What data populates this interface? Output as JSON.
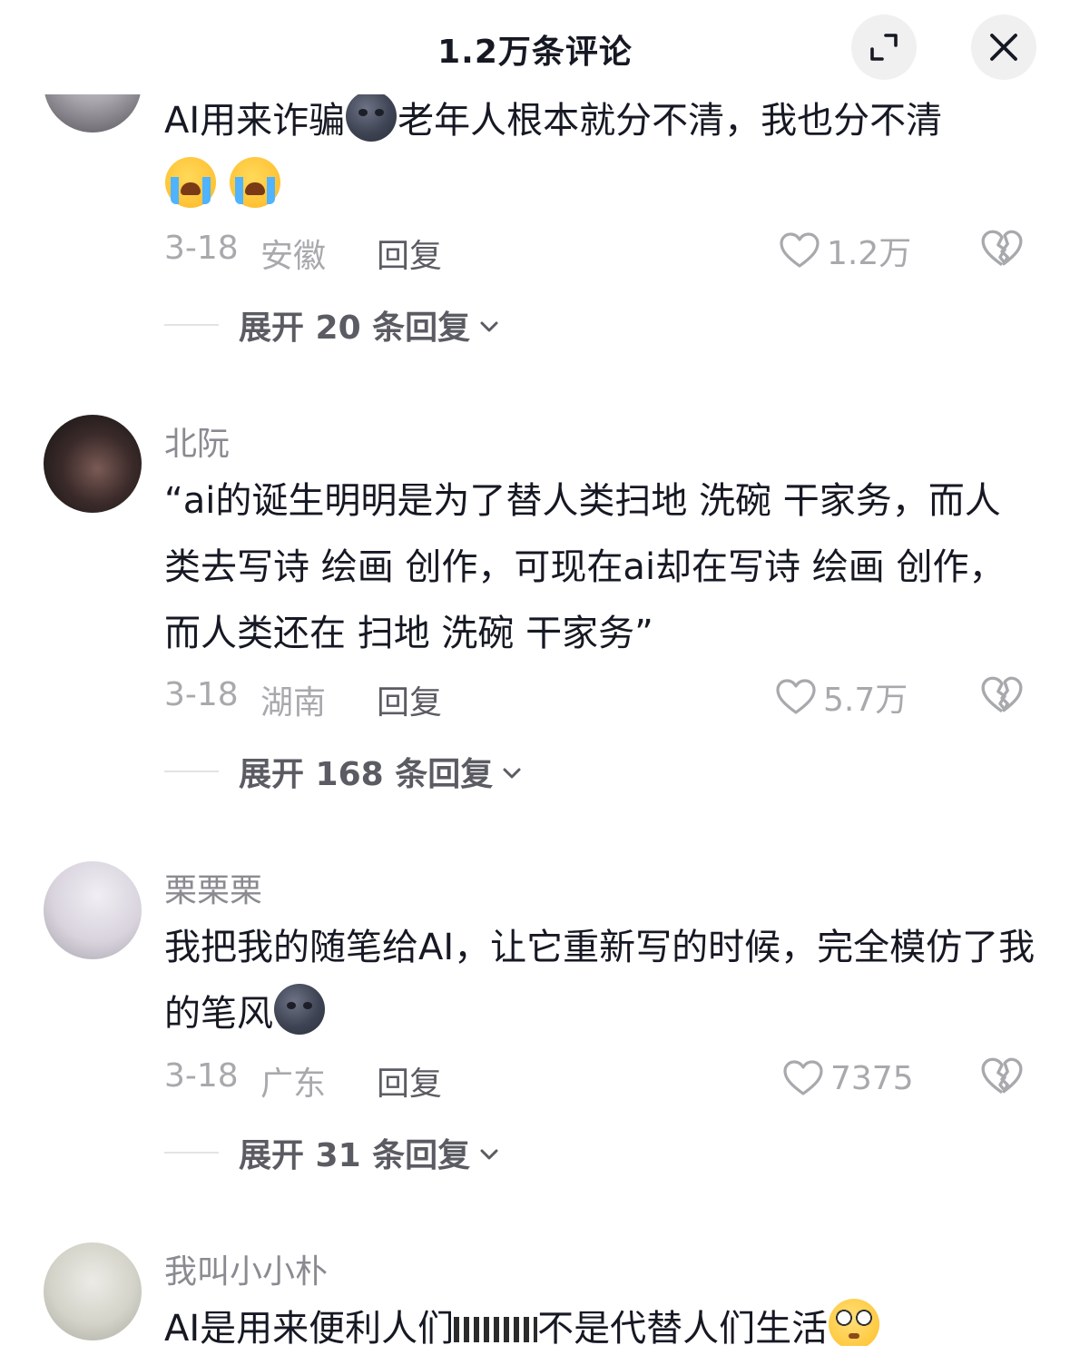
{
  "header": {
    "title": "1.2万条评论",
    "expand_icon": "expand-icon",
    "close_icon": "close-icon"
  },
  "comments": [
    {
      "username": "",
      "text_parts": [
        "AI用来诈骗",
        "老年人根本就分不清，我也分不清"
      ],
      "emojis": [
        "new-moon-face",
        "loudly-crying-face",
        "loudly-crying-face"
      ],
      "date": "3-18",
      "region": "安徽",
      "reply_label": "回复",
      "likes": "1.2万",
      "expand_label": "展开 20 条回复"
    },
    {
      "username": "北阮",
      "text": "“ai的诞生明明是为了替人类扫地 洗碗 干家务，而人类去写诗 绘画 创作，可现在ai却在写诗 绘画 创作，而人类还在 扫地 洗碗 干家务”",
      "date": "3-18",
      "region": "湖南",
      "reply_label": "回复",
      "likes": "5.7万",
      "expand_label": "展开 168 条回复"
    },
    {
      "username": "栗栗栗",
      "text": "我把我的随笔给AI，让它重新写的时候，完全模仿了我的笔风",
      "emojis": [
        "new-moon-face"
      ],
      "date": "3-18",
      "region": "广东",
      "reply_label": "回复",
      "likes": "7375",
      "expand_label": "展开 31 条回复"
    },
    {
      "username": "我叫小小朴",
      "text": "AI是用来便利人们",
      "text_tail": "不是代替人们生活",
      "emojis": [
        "flushed-face"
      ]
    }
  ],
  "colors": {
    "text_primary": "#161823",
    "text_secondary": "#a8a9ad",
    "username": "#8a8b91",
    "reply": "#5b5c63",
    "button_bg": "#f0f0f1"
  }
}
